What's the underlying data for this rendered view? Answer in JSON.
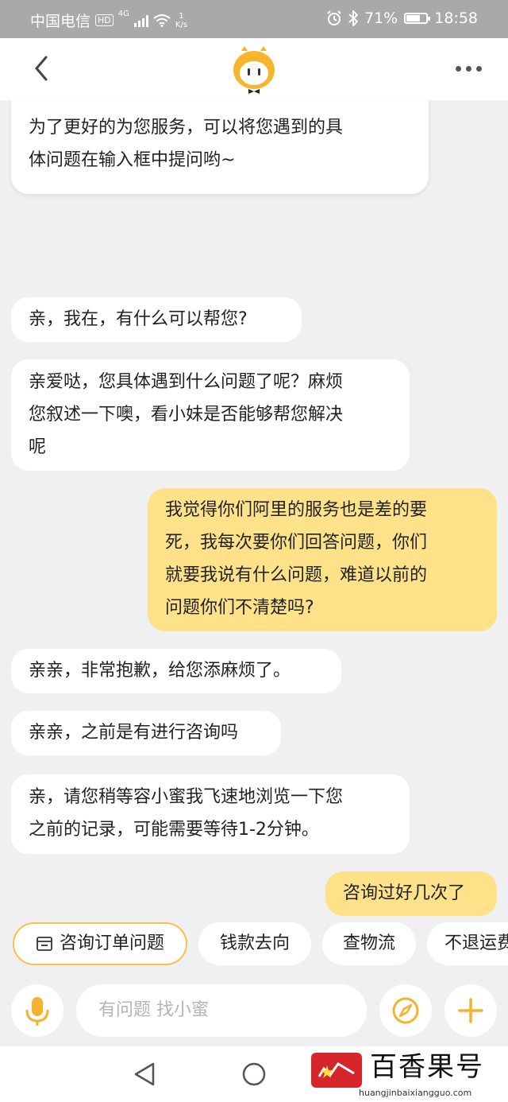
{
  "status_bar": {
    "carrier": "中国电信",
    "hd": "HD",
    "network": "4G",
    "speed_value": "1",
    "speed_unit": "K/s",
    "battery": "71%",
    "battery_level": 0.71,
    "time": "18:58"
  },
  "header": {
    "back_icon": "chevron-left-icon",
    "logo_icon": "mascot-logo-icon",
    "more_icon": "more-dots-icon"
  },
  "messages": [
    {
      "side": "in",
      "text_lines": [
        "为了更好的为您服务，可以将您遇到的具",
        "体问题在输入框中提问哟~"
      ]
    },
    {
      "side": "in",
      "text_lines": [
        "亲，我在，有什么可以帮您?"
      ]
    },
    {
      "side": "in",
      "text_lines": [
        "亲爱哒，您具体遇到什么问题了呢？麻烦",
        "您叙述一下噢，看小妹是否能够帮您解决",
        "呢"
      ]
    },
    {
      "side": "out",
      "text_lines": [
        "我觉得你们阿里的服务也是差的要",
        "死，我每次要你们回答问题，你们",
        "就要我说有什么问题，难道以前的",
        "问题你们不清楚吗?"
      ]
    },
    {
      "side": "in",
      "text_lines": [
        "亲亲，非常抱歉，给您添麻烦了。"
      ]
    },
    {
      "side": "in",
      "text_lines": [
        "亲亲，之前是有进行咨询吗"
      ]
    },
    {
      "side": "in",
      "text_lines": [
        "亲，请您稍等容小蜜我飞速地浏览一下您",
        "之前的记录，可能需要等待1-2分钟。"
      ]
    },
    {
      "side": "out",
      "text_lines": [
        "咨询过好几次了"
      ]
    }
  ],
  "quick_replies": [
    {
      "label": "咨询订单问题",
      "icon": "order-icon"
    },
    {
      "label": "钱款去向"
    },
    {
      "label": "查物流"
    },
    {
      "label": "不退运费"
    }
  ],
  "input_bar": {
    "placeholder": "有问题 找小蜜",
    "mic_icon": "microphone-icon",
    "compass_icon": "compass-icon",
    "plus_icon": "plus-icon"
  },
  "nav_bar": {
    "back_icon": "nav-back-icon",
    "home_icon": "nav-home-icon"
  },
  "watermark": {
    "title": "百香果号",
    "url": "huangjinbaixiangguo.com"
  },
  "colors": {
    "accent": "#f5c24b",
    "outgoing_bubble": "#fde28a",
    "background": "#f0f0f2"
  }
}
